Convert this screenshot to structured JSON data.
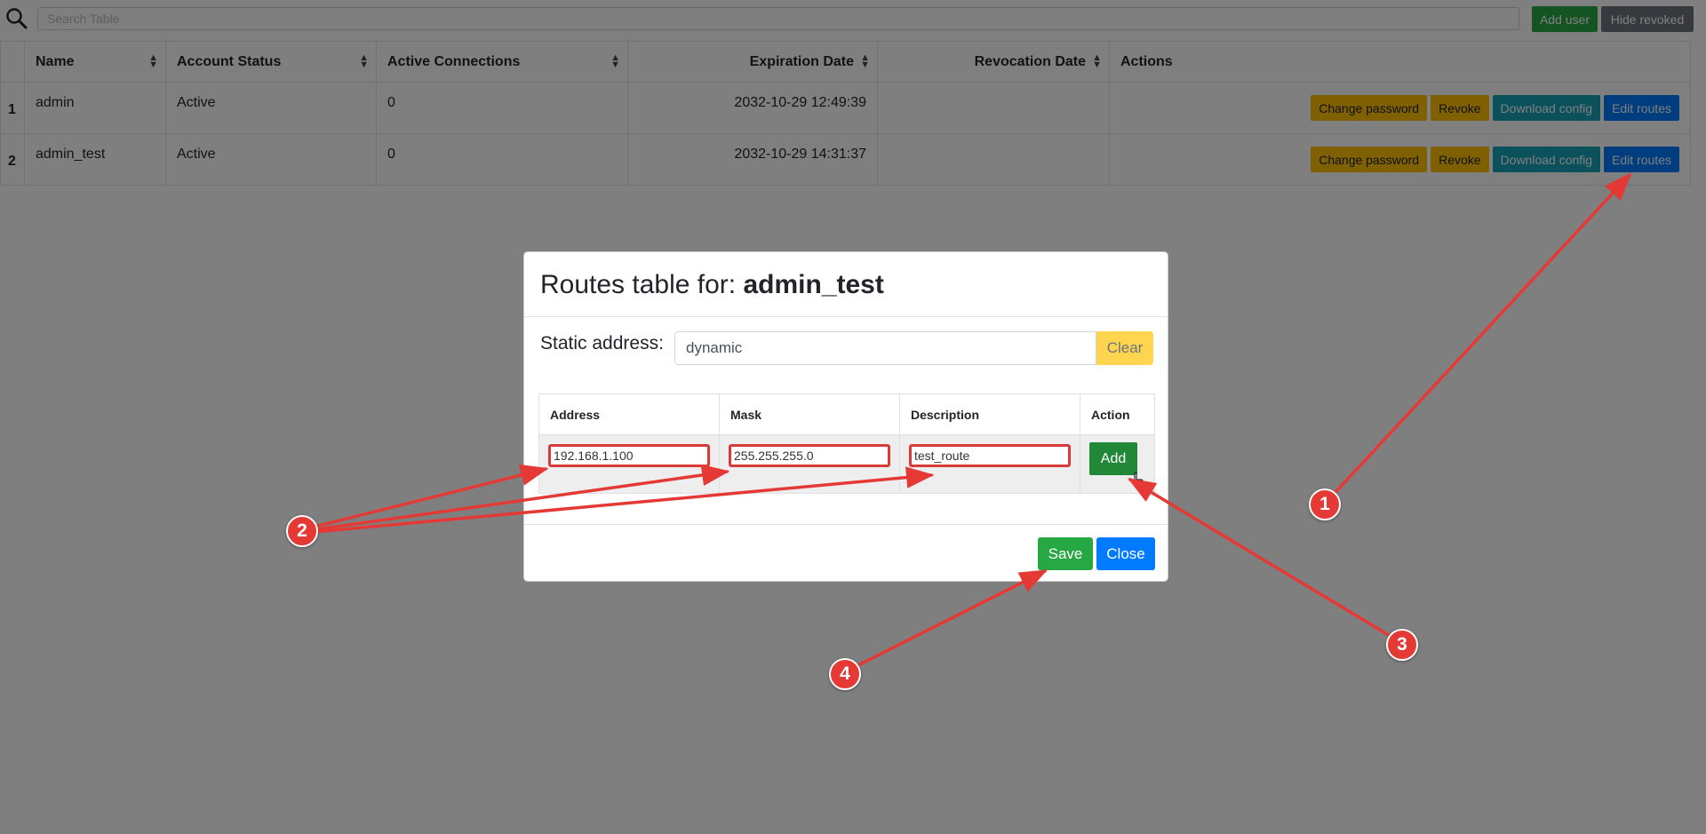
{
  "toolbar": {
    "search_placeholder": "Search Table",
    "add_user_label": "Add user",
    "hide_revoked_label": "Hide revoked"
  },
  "users_table": {
    "columns": [
      "Name",
      "Account Status",
      "Active Connections",
      "Expiration Date",
      "Revocation Date",
      "Actions"
    ],
    "rows": [
      {
        "num": "1",
        "name": "admin",
        "status": "Active",
        "connections": "0",
        "expiration": "2032-10-29 12:49:39",
        "revocation": ""
      },
      {
        "num": "2",
        "name": "admin_test",
        "status": "Active",
        "connections": "0",
        "expiration": "2032-10-29 14:31:37",
        "revocation": ""
      }
    ],
    "row_actions": {
      "change_password": "Change password",
      "revoke": "Revoke",
      "download_config": "Download config",
      "edit_routes": "Edit routes"
    }
  },
  "modal": {
    "title_prefix": "Routes table for: ",
    "title_user": "admin_test",
    "static_label": "Static address:",
    "static_value": "dynamic",
    "clear_label": "Clear",
    "routes_columns": [
      "Address",
      "Mask",
      "Description",
      "Action"
    ],
    "new_route": {
      "address": "192.168.1.100",
      "mask": "255.255.255.0",
      "description": "test_route"
    },
    "add_label": "Add",
    "save_label": "Save",
    "close_label": "Close"
  },
  "annotations": {
    "markers": [
      "1",
      "2",
      "3",
      "4"
    ],
    "color": "#e53935"
  }
}
